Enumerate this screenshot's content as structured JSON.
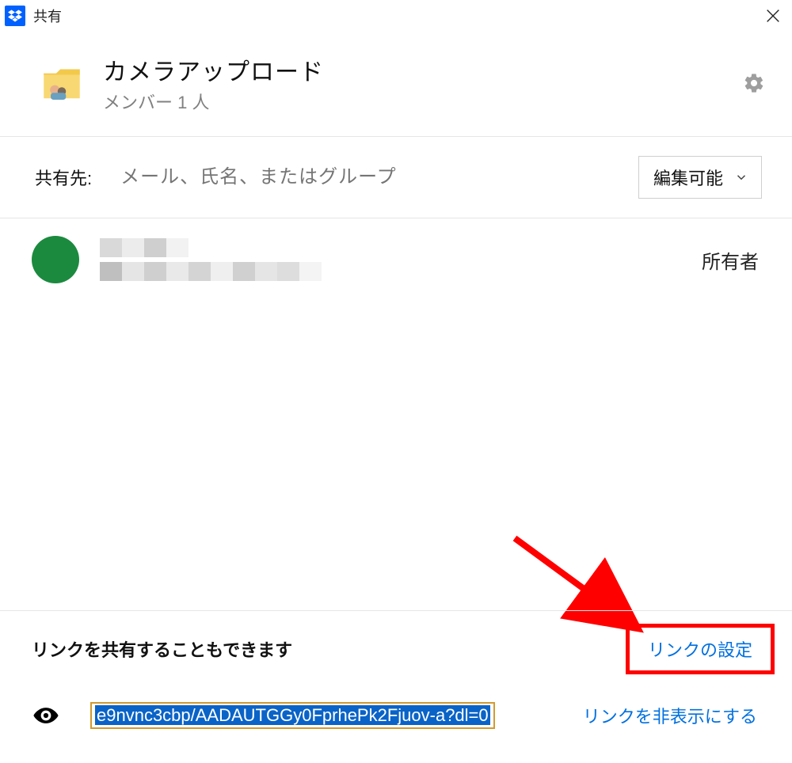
{
  "titlebar": {
    "title": "共有"
  },
  "folder": {
    "name": "カメラアップロード",
    "subtitle": "メンバー 1 人"
  },
  "share": {
    "label": "共有先:",
    "placeholder": "メール、氏名、またはグループ",
    "permission": "編集可能"
  },
  "members": [
    {
      "role": "所有者",
      "avatar_color": "#1b8a3f"
    }
  ],
  "bottom": {
    "heading": "リンクを共有することもできます",
    "link_settings_label": "リンクの設定",
    "hide_link_label": "リンクを非表示にする",
    "url_value": "e9nvnc3cbp/AADAUTGGy0FprhePk2Fjuov-a?dl=0"
  }
}
